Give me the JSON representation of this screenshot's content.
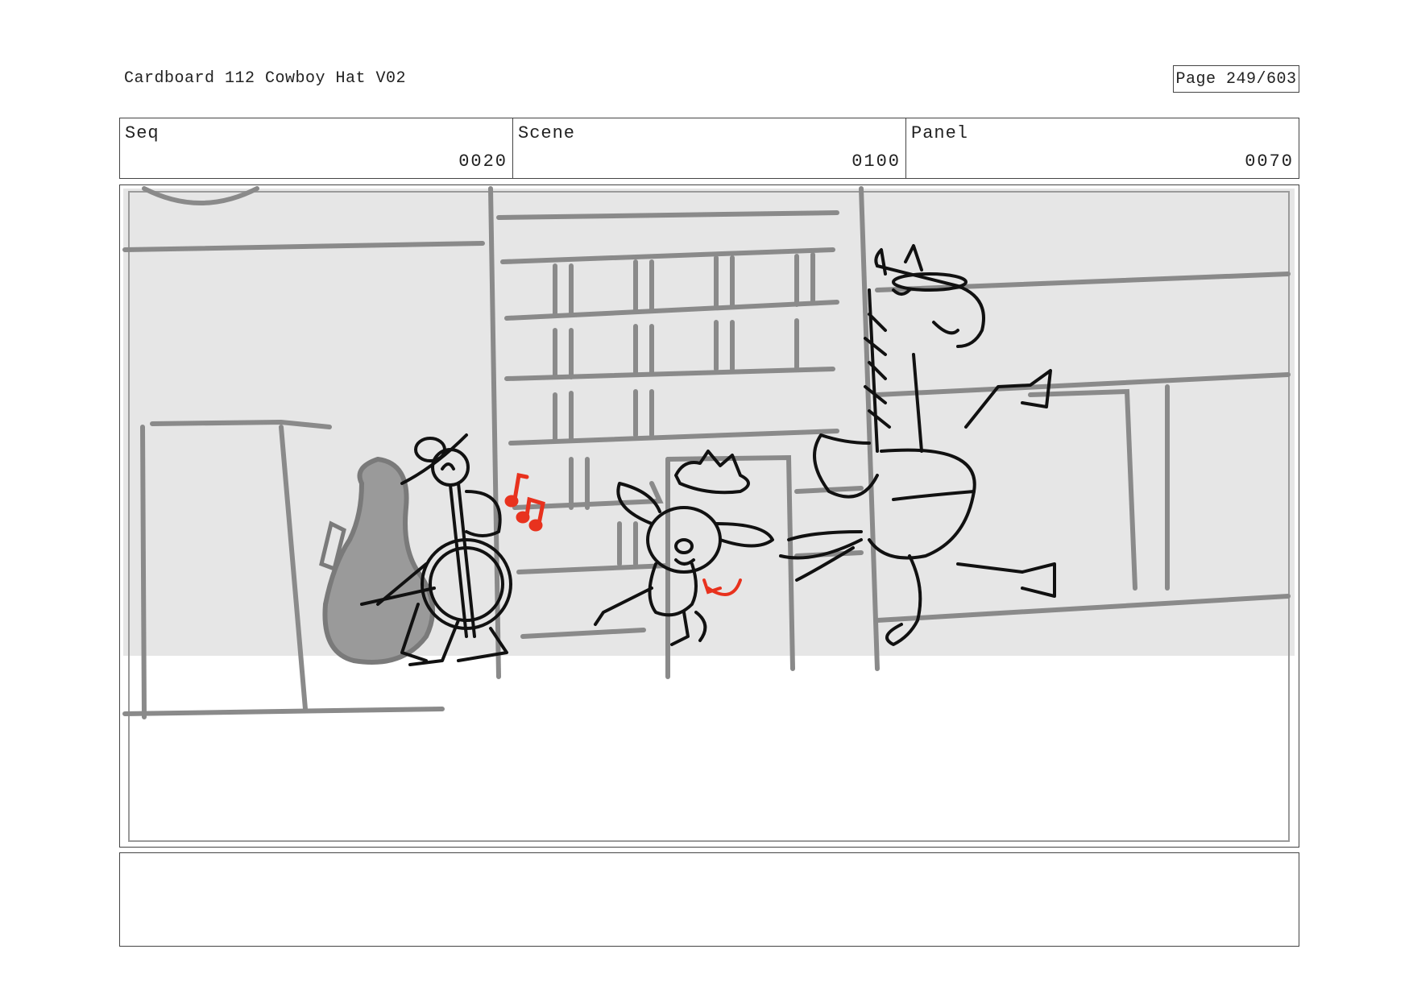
{
  "header": {
    "title": "Cardboard 112 Cowboy Hat V02",
    "page": "Page 249/603"
  },
  "meta": {
    "seq_label": "Seq",
    "seq_value": "0020",
    "scene_label": "Scene",
    "scene_value": "0100",
    "panel_label": "Panel",
    "panel_value": "0070"
  },
  "notes": {
    "text": ""
  },
  "colors": {
    "sketch_line": "#111111",
    "background_line": "#8a8a8a",
    "accent_red": "#e8321e",
    "panel_fill": "#e6e6e6"
  }
}
